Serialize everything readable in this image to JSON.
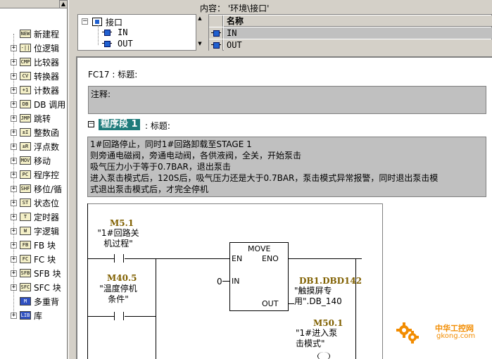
{
  "catalog": {
    "items": [
      {
        "icon": "new-network-icon",
        "icon_glyph": "NEW",
        "label": "新建程",
        "expandable": false
      },
      {
        "icon": "bit-logic-icon",
        "icon_glyph": "-||",
        "label": "位逻辑",
        "expandable": true
      },
      {
        "icon": "comparator-icon",
        "icon_glyph": "CMP",
        "label": "比较器",
        "expandable": true
      },
      {
        "icon": "converter-icon",
        "icon_glyph": "CV",
        "label": "转换器",
        "expandable": true
      },
      {
        "icon": "counter-icon",
        "icon_glyph": "+1",
        "label": "计数器",
        "expandable": true
      },
      {
        "icon": "db-call-icon",
        "icon_glyph": "DB",
        "label": "DB 调用",
        "expandable": true
      },
      {
        "icon": "jump-icon",
        "icon_glyph": "JMP",
        "label": "跳转",
        "expandable": true
      },
      {
        "icon": "integer-math-icon",
        "icon_glyph": "±I",
        "label": "整数函",
        "expandable": true
      },
      {
        "icon": "float-math-icon",
        "icon_glyph": "±R",
        "label": "浮点数",
        "expandable": true
      },
      {
        "icon": "move-icon",
        "icon_glyph": "MOV",
        "label": "移动",
        "expandable": true
      },
      {
        "icon": "program-control-icon",
        "icon_glyph": "PC",
        "label": "程序控",
        "expandable": true
      },
      {
        "icon": "shift-rotate-icon",
        "icon_glyph": "SHF",
        "label": "移位/循",
        "expandable": true
      },
      {
        "icon": "status-bits-icon",
        "icon_glyph": "ST",
        "label": "状态位",
        "expandable": true
      },
      {
        "icon": "timer-icon",
        "icon_glyph": "T",
        "label": "定时器",
        "expandable": true
      },
      {
        "icon": "word-logic-icon",
        "icon_glyph": "W",
        "label": "字逻辑",
        "expandable": true
      },
      {
        "icon": "fb-block-icon",
        "icon_glyph": "FB",
        "label": "FB 块",
        "expandable": true
      },
      {
        "icon": "fc-block-icon",
        "icon_glyph": "FC",
        "label": "FC 块",
        "expandable": true
      },
      {
        "icon": "sfb-block-icon",
        "icon_glyph": "SFB",
        "label": "SFB 块",
        "expandable": true
      },
      {
        "icon": "sfc-block-icon",
        "icon_glyph": "SFC",
        "label": "SFC 块",
        "expandable": true
      },
      {
        "icon": "multi-instance-icon",
        "icon_glyph": "M",
        "label": "多重背",
        "expandable": false
      },
      {
        "icon": "library-icon",
        "icon_glyph": "LIB",
        "label": "库",
        "expandable": true
      }
    ]
  },
  "content_label": "内容：  '环境\\接口'",
  "interface_tree": {
    "root": "接口",
    "children": [
      "IN",
      "OUT"
    ]
  },
  "interface_table": {
    "header": "名称",
    "rows": [
      "IN",
      "OUT"
    ]
  },
  "editor": {
    "fc_title": "FC17 : 标题:",
    "comment_label": "注释:",
    "network_label": "程序段 1",
    "network_title": ": 标题:",
    "network_comment": [
      "1#回路停止，同时1#回路卸载至STAGE 1",
      "则旁通电磁阀，旁通电动阀，各供液阀，全关，开始泵击",
      "吸气压力小于等于0.7BAR，退出泵击",
      "进入泵击模式后，120S后，吸气压力还是大于0.7BAR，泵击模式异常报警，同时退出泵击模",
      "式退出泵击模式后，才完全停机"
    ]
  },
  "ladder": {
    "contact1_addr": "M5.1",
    "contact1_sym_line1": "\"1#回路关",
    "contact1_sym_line2": "机过程\"",
    "contact2_addr": "M40.5",
    "contact2_sym_line1": "\"温度停机",
    "contact2_sym_line2": "条件\"",
    "move_title": "MOVE",
    "move_en": "EN",
    "move_eno": "ENO",
    "move_in": "IN",
    "move_out": "OUT",
    "in_value": "0",
    "out_addr": "DB1.DBD142",
    "out_sym_line1": "\"触摸屏专",
    "out_sym_line2": "用\".DB_140",
    "coil_addr": "M50.1",
    "coil_sym_line1": "\"1#进入泵",
    "coil_sym_line2": "击模式\""
  },
  "watermark": {
    "text": "中华工控网",
    "url": "gkong.com"
  }
}
